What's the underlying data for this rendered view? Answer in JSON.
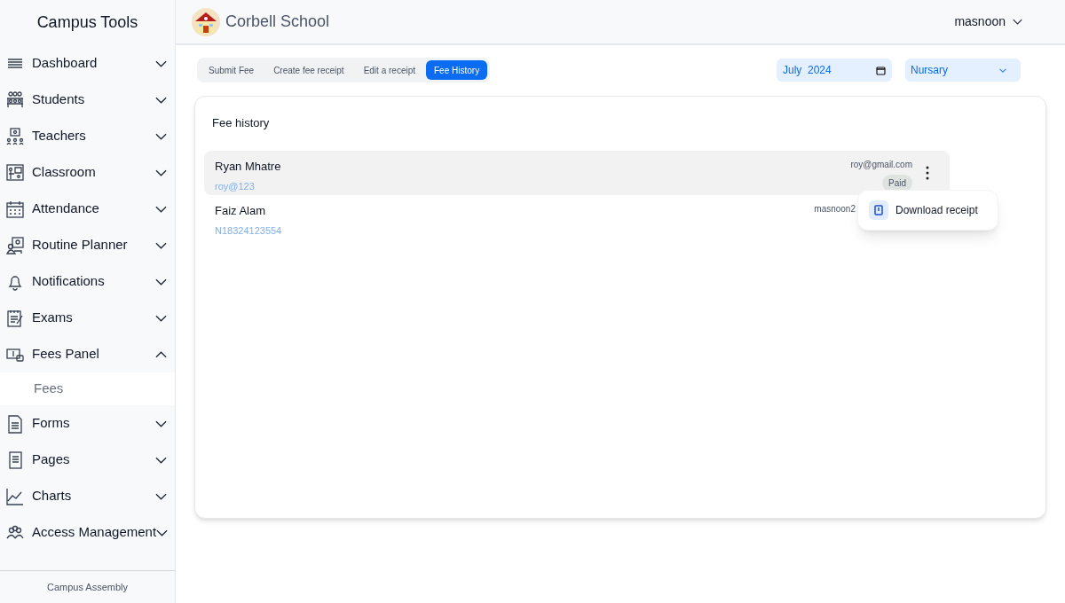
{
  "sidebar": {
    "title": "Campus Tools",
    "items": [
      {
        "label": "Dashboard",
        "expanded": false
      },
      {
        "label": "Students",
        "expanded": false
      },
      {
        "label": "Teachers",
        "expanded": false
      },
      {
        "label": "Classroom",
        "expanded": false
      },
      {
        "label": "Attendance",
        "expanded": false
      },
      {
        "label": "Routine Planner",
        "expanded": false
      },
      {
        "label": "Notifications",
        "expanded": false
      },
      {
        "label": "Exams",
        "expanded": false
      },
      {
        "label": "Fees Panel",
        "expanded": true,
        "children": [
          {
            "label": "Fees"
          }
        ]
      },
      {
        "label": "Forms",
        "expanded": false
      },
      {
        "label": "Pages",
        "expanded": false
      },
      {
        "label": "Charts",
        "expanded": false
      },
      {
        "label": "Access Management",
        "expanded": false
      }
    ],
    "footer": "Campus Assembly"
  },
  "header": {
    "school": "Corbell School",
    "user": "masnoon"
  },
  "tabs": [
    {
      "label": "Submit Fee",
      "selected": false
    },
    {
      "label": "Create fee receipt",
      "selected": false
    },
    {
      "label": "Edit a receipt",
      "selected": false
    },
    {
      "label": "Fee History",
      "selected": true
    }
  ],
  "month_field": {
    "value": "July  2024"
  },
  "class_select": {
    "value": "Nursary"
  },
  "card": {
    "title": "Fee history",
    "rows": [
      {
        "name": "Ryan Mhatre",
        "id": "roy@123",
        "email": "roy@gmail.com",
        "status": "Paid",
        "highlighted": true
      },
      {
        "name": "Faiz Alam",
        "id": "N18324123554",
        "email": "masnoon2",
        "highlighted": false
      }
    ]
  },
  "menu": {
    "items": [
      "Download receipt"
    ]
  }
}
